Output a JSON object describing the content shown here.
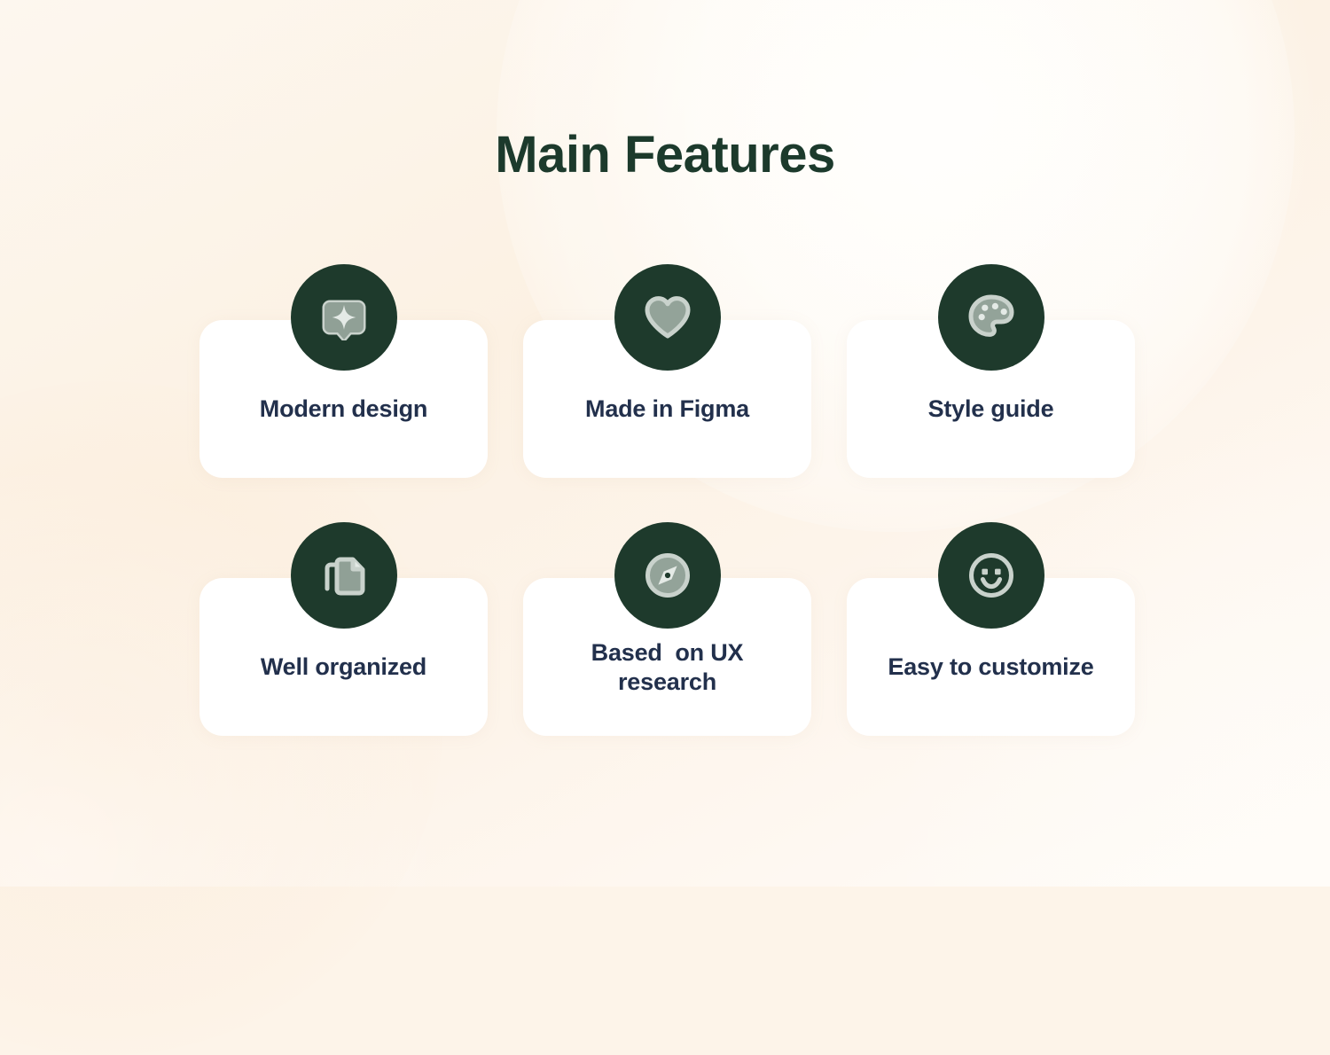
{
  "page": {
    "title": "Main Features",
    "title_color": "#1C3A2C",
    "background_color": "#FDF4E9",
    "card_color": "#FFFFFF",
    "badge_color": "#1E3A2C",
    "icon_color": "#9FADA3",
    "label_color": "#22304C"
  },
  "features": [
    {
      "label": "Modern design",
      "icon": "sparkle-bubble-icon"
    },
    {
      "label": "Made in Figma",
      "icon": "heart-icon"
    },
    {
      "label": "Style guide",
      "icon": "palette-icon"
    },
    {
      "label": "Well organized",
      "icon": "copy-documents-icon"
    },
    {
      "label": "Based  on UX\nresearch",
      "icon": "compass-icon"
    },
    {
      "label": "Easy to customize",
      "icon": "smiley-face-icon"
    }
  ]
}
